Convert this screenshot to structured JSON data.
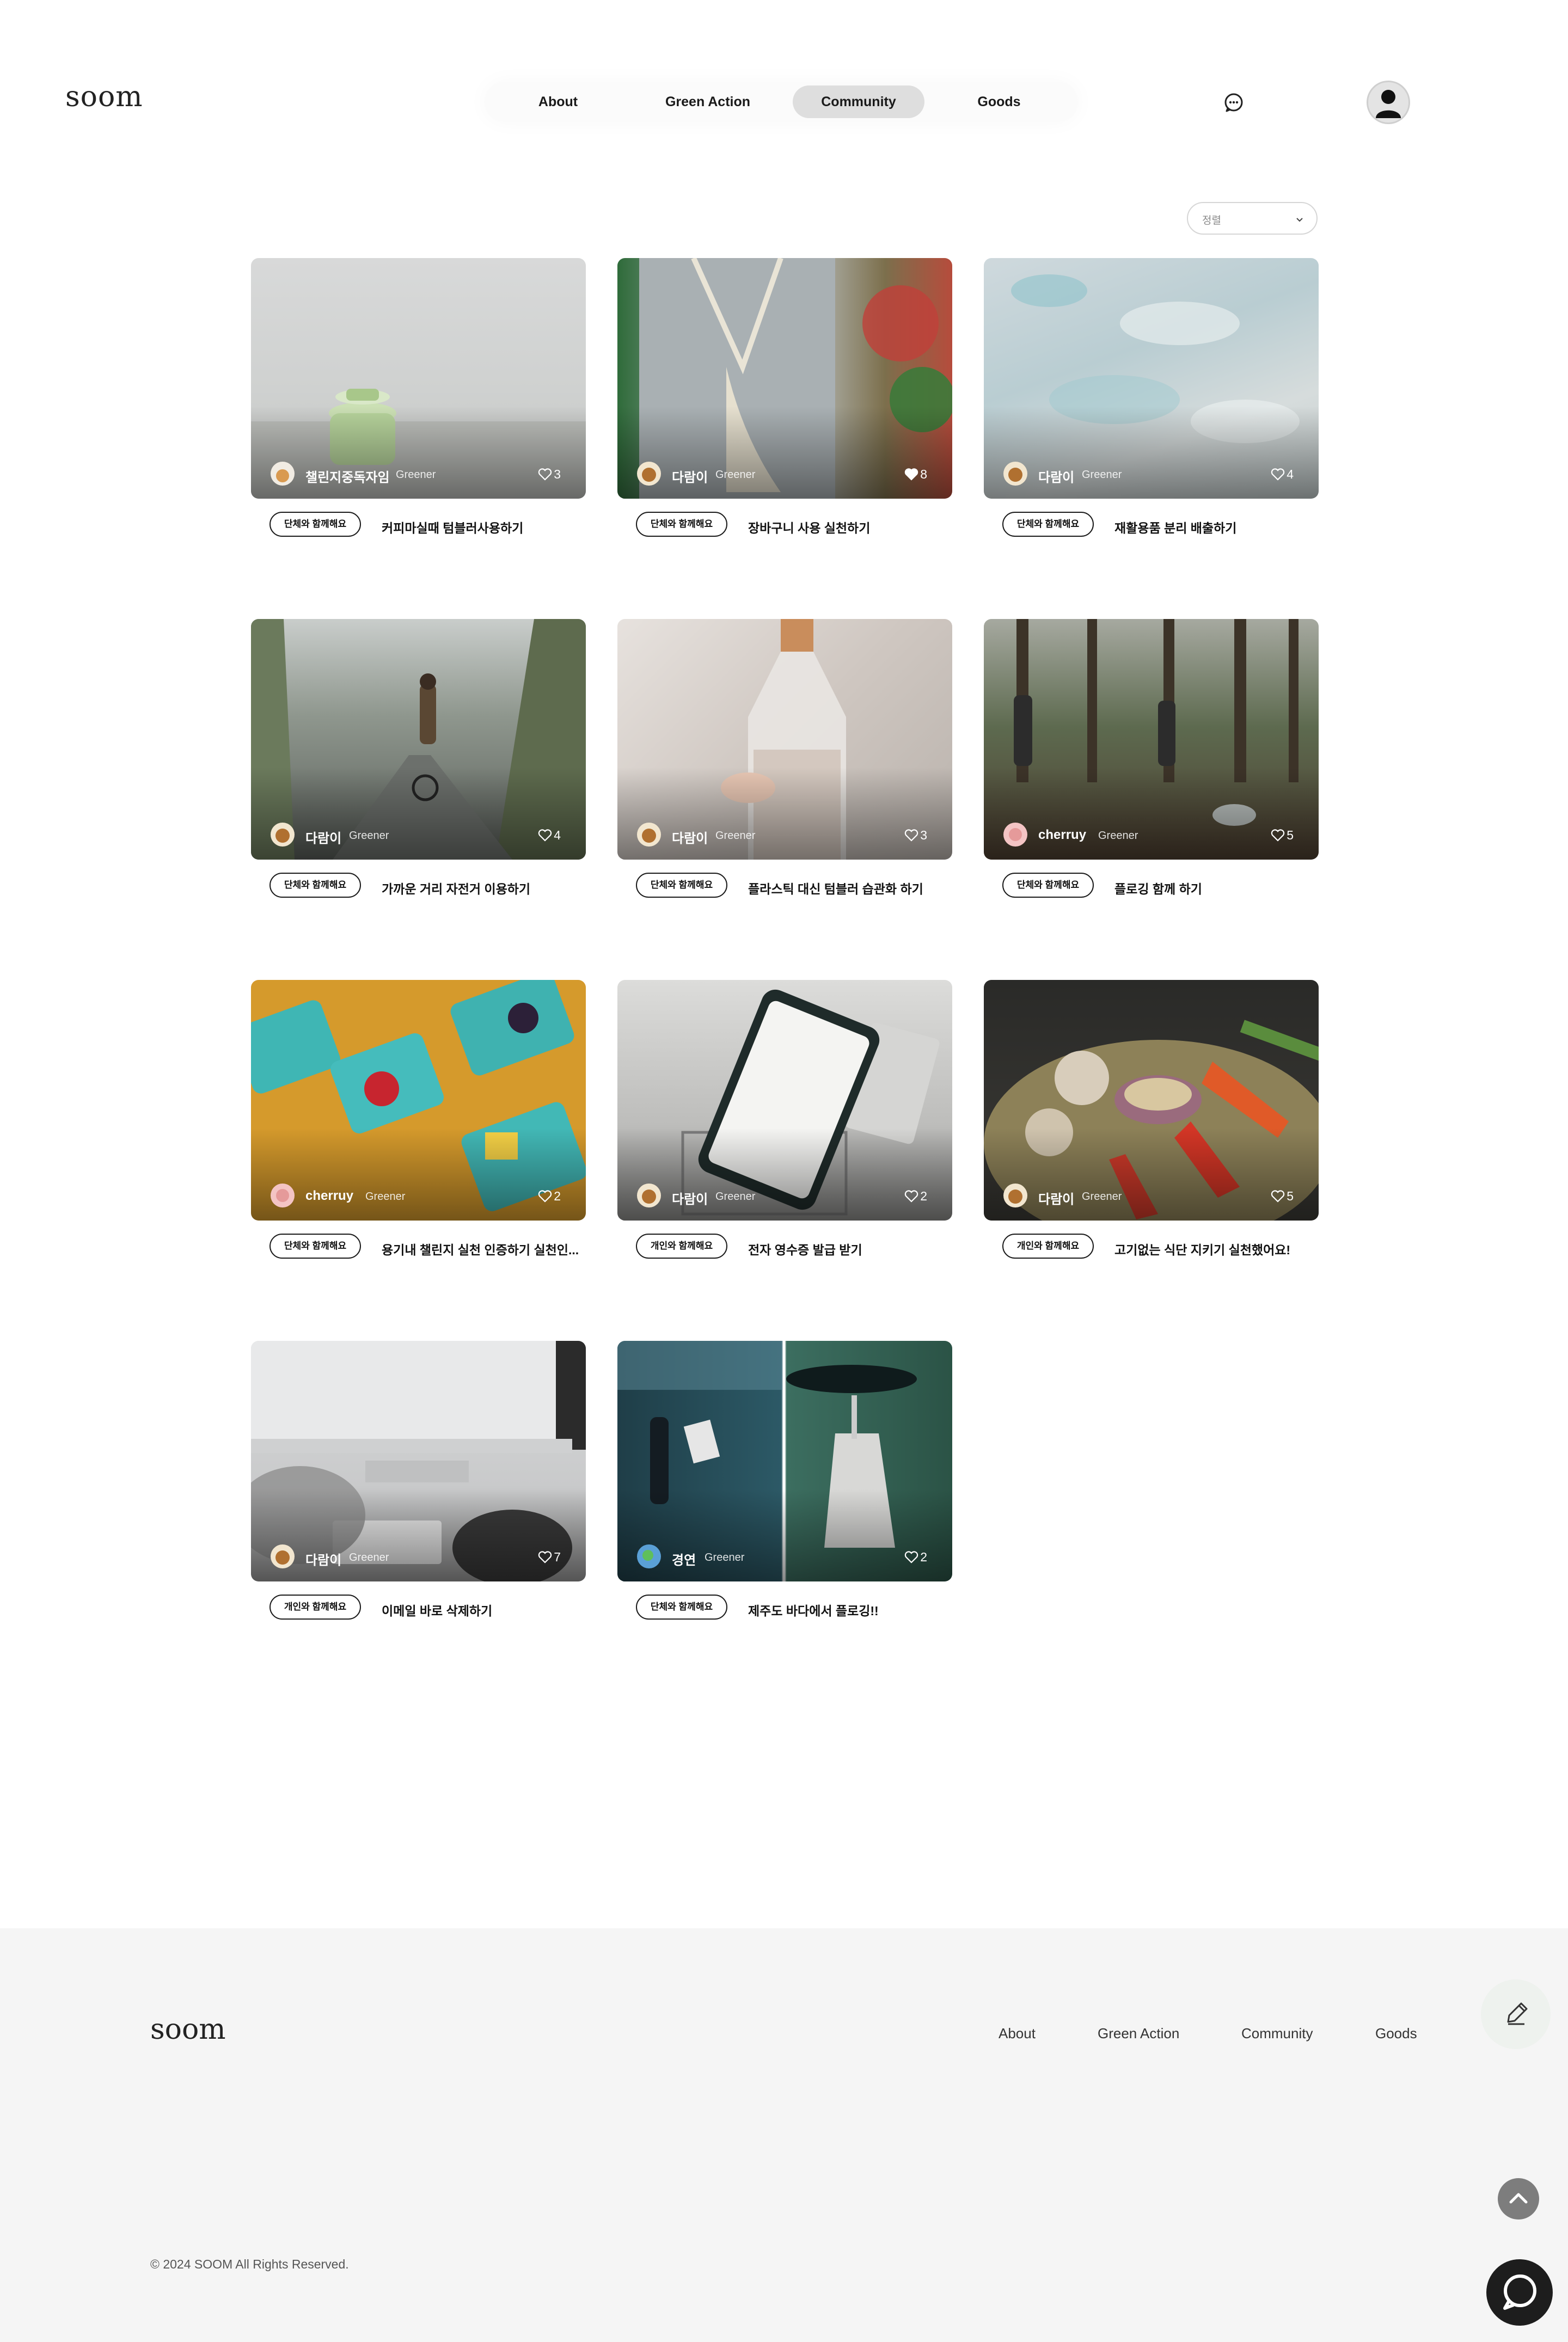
{
  "brand": {
    "logo_text": "soom"
  },
  "nav": {
    "items": [
      {
        "label": "About",
        "active": false
      },
      {
        "label": "Green Action",
        "active": false
      },
      {
        "label": "Community",
        "active": true
      },
      {
        "label": "Goods",
        "active": false
      }
    ],
    "chat_icon": "chat-bubble-icon",
    "profile_icon": "user-avatar-icon"
  },
  "sort": {
    "label": "정렬",
    "icon": "chevron-down-icon"
  },
  "colors": {
    "nav_active": "#dedede",
    "footer_bg": "#f5f5f5",
    "tag_border": "#1a1a1a",
    "fab_dark": "#1d1d1d"
  },
  "posts": [
    {
      "author": "챌린지중독자임",
      "level": "Greener",
      "likes": "3",
      "liked": false,
      "tag": "단체와 함께해요",
      "title": "커피마실때 텀블러사용하기"
    },
    {
      "author": "다람이",
      "level": "Greener",
      "likes": "8",
      "liked": true,
      "tag": "단체와 함께해요",
      "title": "장바구니 사용 실천하기"
    },
    {
      "author": "다람이",
      "level": "Greener",
      "likes": "4",
      "liked": false,
      "tag": "단체와 함께해요",
      "title": "재활용품 분리 배출하기"
    },
    {
      "author": "다람이",
      "level": "Greener",
      "likes": "4",
      "liked": false,
      "tag": "단체와 함께해요",
      "title": "가까운 거리 자전거 이용하기"
    },
    {
      "author": "다람이",
      "level": "Greener",
      "likes": "3",
      "liked": false,
      "tag": "단체와 함께해요",
      "title": "플라스틱 대신 텀블러 습관화 하기"
    },
    {
      "author": "cherruy",
      "level": "Greener",
      "likes": "5",
      "liked": false,
      "tag": "단체와 함께해요",
      "title": "플로깅 함께 하기"
    },
    {
      "author": "cherruy",
      "level": "Greener",
      "likes": "2",
      "liked": false,
      "tag": "단체와 함께해요",
      "title": "용기내 챌린지 실천 인증하기 실천인..."
    },
    {
      "author": "다람이",
      "level": "Greener",
      "likes": "2",
      "liked": false,
      "tag": "개인와 함께해요",
      "title": "전자 영수증 발급 받기"
    },
    {
      "author": "다람이",
      "level": "Greener",
      "likes": "5",
      "liked": false,
      "tag": "개인와 함께해요",
      "title": "고기없는 식단 지키기 실천했어요!"
    },
    {
      "author": "다람이",
      "level": "Greener",
      "likes": "7",
      "liked": false,
      "tag": "개인와 함께해요",
      "title": "이메일 바로 삭제하기"
    },
    {
      "author": "경연",
      "level": "Greener",
      "likes": "2",
      "liked": false,
      "tag": "단체와 함께해요",
      "title": "제주도 바다에서 플로깅!!"
    }
  ],
  "footer": {
    "logo_text": "soom",
    "links": [
      "About",
      "Green Action",
      "Community",
      "Goods"
    ],
    "copyright": "© 2024 SOOM All Rights Reserved."
  },
  "fabs": {
    "write_icon": "pencil-icon",
    "top_icon": "chevron-up-icon",
    "chat_icon": "chat-bubble-icon"
  }
}
